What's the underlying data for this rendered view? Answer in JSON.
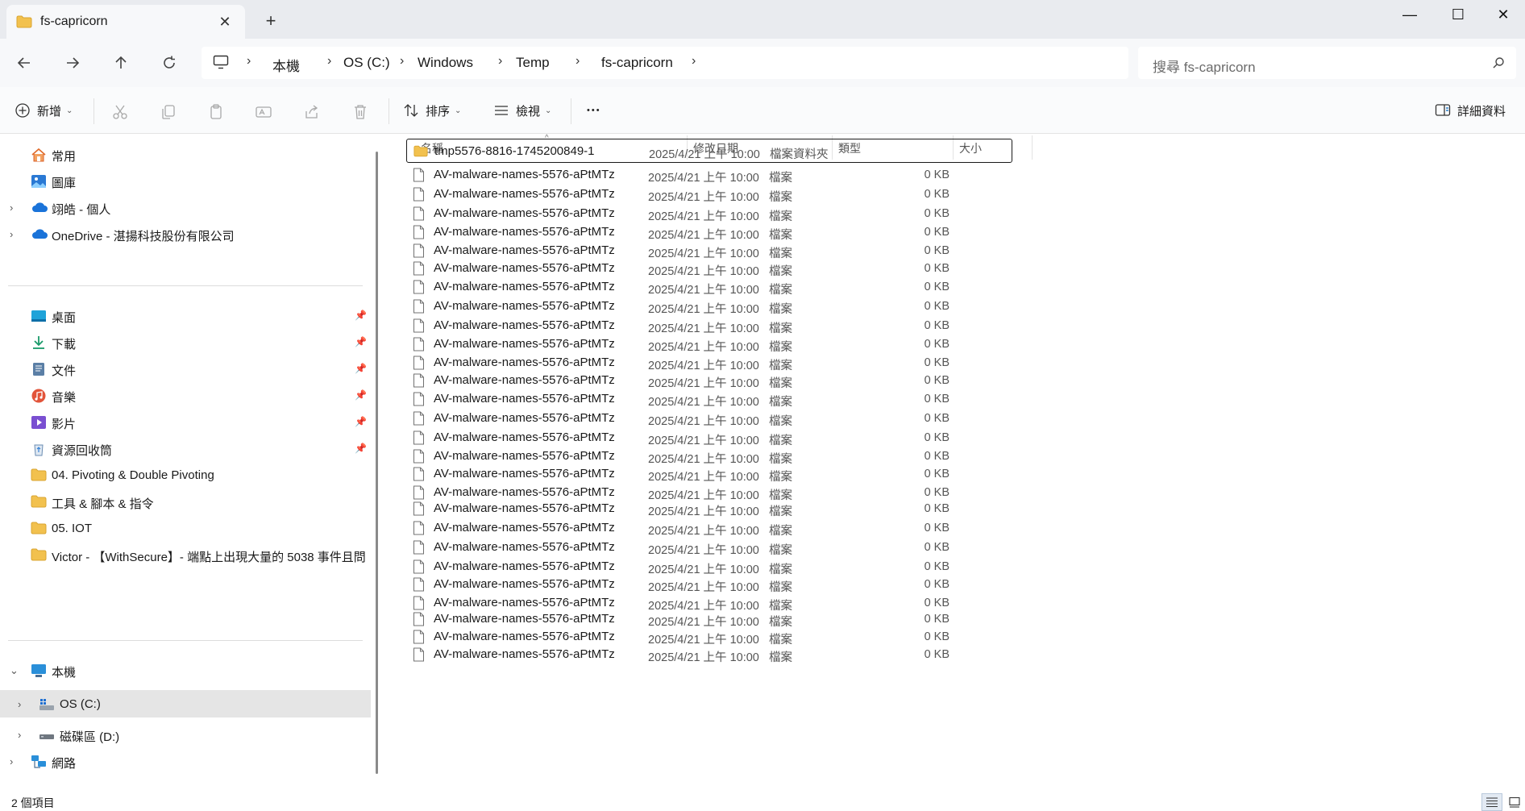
{
  "window": {
    "tab_title": "fs-capricorn",
    "close_tab_glyph": "✕",
    "new_tab_glyph": "+",
    "minimize_glyph": "—",
    "maximize_glyph": "☐",
    "close_glyph": "✕"
  },
  "nav": {
    "breadcrumbs": [
      "本機",
      "OS (C:)",
      "Windows",
      "Temp",
      "fs-capricorn"
    ],
    "separator": "›",
    "search_placeholder": "搜尋 fs-capricorn"
  },
  "toolbar": {
    "new_label": "新增",
    "sort_label": "排序",
    "view_label": "檢視",
    "more_glyph": "•••",
    "details_label": "詳細資料"
  },
  "sidebar": {
    "quick": [
      {
        "label": "常用",
        "icon": "home-icon",
        "expandable": false
      },
      {
        "label": "圖庫",
        "icon": "gallery-icon",
        "expandable": false
      },
      {
        "label": "翊皓 - 個人",
        "icon": "cloud-icon",
        "expandable": true
      },
      {
        "label": "OneDrive - 湛揚科技股份有限公司",
        "icon": "cloud-icon",
        "expandable": true
      }
    ],
    "pinned": [
      {
        "label": "桌面",
        "icon": "desktop-icon",
        "pinned": true
      },
      {
        "label": "下載",
        "icon": "download-icon",
        "pinned": true
      },
      {
        "label": "文件",
        "icon": "documents-icon",
        "pinned": true
      },
      {
        "label": "音樂",
        "icon": "music-icon",
        "pinned": true
      },
      {
        "label": "影片",
        "icon": "videos-icon",
        "pinned": true
      },
      {
        "label": "資源回收筒",
        "icon": "recycle-bin-icon",
        "pinned": true
      },
      {
        "label": "04. Pivoting & Double Pivoting",
        "icon": "folder-icon",
        "pinned": false
      },
      {
        "label": "工具 & 腳本 & 指令",
        "icon": "folder-icon",
        "pinned": false
      },
      {
        "label": "05. IOT",
        "icon": "folder-icon",
        "pinned": false
      },
      {
        "label": "Victor - 【WithSecure】- 端點上出現大量的 5038 事件且問",
        "icon": "folder-icon",
        "pinned": false
      }
    ],
    "pc": [
      {
        "label": "本機",
        "icon": "pc-icon",
        "expand": "⌄",
        "indent": 0,
        "selected": false
      },
      {
        "label": "OS (C:)",
        "icon": "drive-icon",
        "expand": "›",
        "indent": 1,
        "selected": true
      },
      {
        "label": "磁碟區 (D:)",
        "icon": "drive-icon",
        "expand": "›",
        "indent": 1,
        "selected": false
      },
      {
        "label": "網路",
        "icon": "network-icon",
        "expand": "›",
        "indent": 0,
        "selected": false
      }
    ]
  },
  "columns": {
    "name": "名稱",
    "date": "修改日期",
    "type": "類型",
    "size": "大小"
  },
  "files": [
    {
      "name": "tmp5576-8816-1745200849-1",
      "date": "2025/4/21 上午 10:00",
      "type": "檔案資料夾",
      "size": "",
      "kind": "folder"
    },
    {
      "name": "AV-malware-names-5576-aPtMTz",
      "date": "2025/4/21 上午 10:00",
      "type": "檔案",
      "size": "0 KB",
      "kind": "file"
    },
    {
      "name": "AV-malware-names-5576-aPtMTz",
      "date": "2025/4/21 上午 10:00",
      "type": "檔案",
      "size": "0 KB",
      "kind": "file"
    },
    {
      "name": "AV-malware-names-5576-aPtMTz",
      "date": "2025/4/21 上午 10:00",
      "type": "檔案",
      "size": "0 KB",
      "kind": "file"
    },
    {
      "name": "AV-malware-names-5576-aPtMTz",
      "date": "2025/4/21 上午 10:00",
      "type": "檔案",
      "size": "0 KB",
      "kind": "file"
    },
    {
      "name": "AV-malware-names-5576-aPtMTz",
      "date": "2025/4/21 上午 10:00",
      "type": "檔案",
      "size": "0 KB",
      "kind": "file"
    },
    {
      "name": "AV-malware-names-5576-aPtMTz",
      "date": "2025/4/21 上午 10:00",
      "type": "檔案",
      "size": "0 KB",
      "kind": "file"
    },
    {
      "name": "AV-malware-names-5576-aPtMTz",
      "date": "2025/4/21 上午 10:00",
      "type": "檔案",
      "size": "0 KB",
      "kind": "file"
    },
    {
      "name": "AV-malware-names-5576-aPtMTz",
      "date": "2025/4/21 上午 10:00",
      "type": "檔案",
      "size": "0 KB",
      "kind": "file"
    },
    {
      "name": "AV-malware-names-5576-aPtMTz",
      "date": "2025/4/21 上午 10:00",
      "type": "檔案",
      "size": "0 KB",
      "kind": "file"
    },
    {
      "name": "AV-malware-names-5576-aPtMTz",
      "date": "2025/4/21 上午 10:00",
      "type": "檔案",
      "size": "0 KB",
      "kind": "file"
    },
    {
      "name": "AV-malware-names-5576-aPtMTz",
      "date": "2025/4/21 上午 10:00",
      "type": "檔案",
      "size": "0 KB",
      "kind": "file"
    },
    {
      "name": "AV-malware-names-5576-aPtMTz",
      "date": "2025/4/21 上午 10:00",
      "type": "檔案",
      "size": "0 KB",
      "kind": "file"
    },
    {
      "name": "AV-malware-names-5576-aPtMTz",
      "date": "2025/4/21 上午 10:00",
      "type": "檔案",
      "size": "0 KB",
      "kind": "file"
    },
    {
      "name": "AV-malware-names-5576-aPtMTz",
      "date": "2025/4/21 上午 10:00",
      "type": "檔案",
      "size": "0 KB",
      "kind": "file"
    },
    {
      "name": "AV-malware-names-5576-aPtMTz",
      "date": "2025/4/21 上午 10:00",
      "type": "檔案",
      "size": "0 KB",
      "kind": "file"
    },
    {
      "name": "AV-malware-names-5576-aPtMTz",
      "date": "2025/4/21 上午 10:00",
      "type": "檔案",
      "size": "0 KB",
      "kind": "file"
    },
    {
      "name": "AV-malware-names-5576-aPtMTz",
      "date": "2025/4/21 上午 10:00",
      "type": "檔案",
      "size": "0 KB",
      "kind": "file"
    },
    {
      "name": "AV-malware-names-5576-aPtMTz",
      "date": "2025/4/21 上午 10:00",
      "type": "檔案",
      "size": "0 KB",
      "kind": "file"
    },
    {
      "name": "AV-malware-names-5576-aPtMTz",
      "date": "2025/4/21 上午 10:00",
      "type": "檔案",
      "size": "0 KB",
      "kind": "file"
    },
    {
      "name": "AV-malware-names-5576-aPtMTz",
      "date": "2025/4/21 上午 10:00",
      "type": "檔案",
      "size": "0 KB",
      "kind": "file"
    },
    {
      "name": "AV-malware-names-5576-aPtMTz",
      "date": "2025/4/21 上午 10:00",
      "type": "檔案",
      "size": "0 KB",
      "kind": "file"
    },
    {
      "name": "AV-malware-names-5576-aPtMTz",
      "date": "2025/4/21 上午 10:00",
      "type": "檔案",
      "size": "0 KB",
      "kind": "file"
    },
    {
      "name": "AV-malware-names-5576-aPtMTz",
      "date": "2025/4/21 上午 10:00",
      "type": "檔案",
      "size": "0 KB",
      "kind": "file"
    },
    {
      "name": "AV-malware-names-5576-aPtMTz",
      "date": "2025/4/21 上午 10:00",
      "type": "檔案",
      "size": "0 KB",
      "kind": "file"
    },
    {
      "name": "AV-malware-names-5576-aPtMTz",
      "date": "2025/4/21 上午 10:00",
      "type": "檔案",
      "size": "0 KB",
      "kind": "file"
    },
    {
      "name": "AV-malware-names-5576-aPtMTz",
      "date": "2025/4/21 上午 10:00",
      "type": "檔案",
      "size": "0 KB",
      "kind": "file"
    },
    {
      "name": "AV-malware-names-5576-aPtMTz",
      "date": "2025/4/21 上午 10:00",
      "type": "檔案",
      "size": "0 KB",
      "kind": "file"
    }
  ],
  "status": {
    "item_count": "2 個項目"
  },
  "colors": {
    "folder": "#f2c14e",
    "accent": "#0067c0",
    "onedrive": "#1a73d9"
  }
}
